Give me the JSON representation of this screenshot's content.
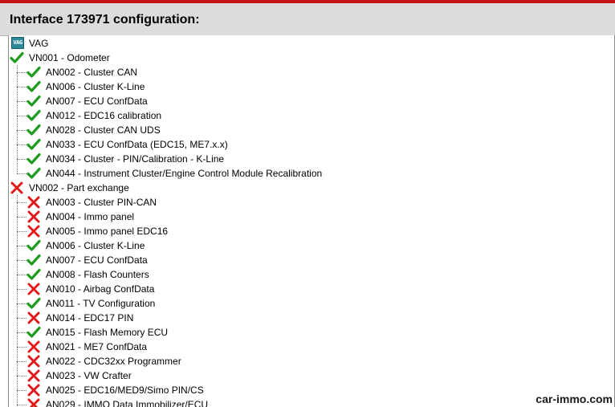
{
  "header": {
    "title": "Interface 173971 configuration:"
  },
  "tree": {
    "root": {
      "label": "VAG",
      "icon": "vag-logo-icon"
    },
    "groups": [
      {
        "label": "VN001 - Odometer",
        "status": "enabled",
        "items": [
          {
            "label": "AN002 - Cluster CAN",
            "status": "enabled"
          },
          {
            "label": "AN006 - Cluster K-Line",
            "status": "enabled"
          },
          {
            "label": "AN007 - ECU ConfData",
            "status": "enabled"
          },
          {
            "label": "AN012 - EDC16 calibration",
            "status": "enabled"
          },
          {
            "label": "AN028 - Cluster CAN UDS",
            "status": "enabled"
          },
          {
            "label": "AN033 - ECU ConfData (EDC15, ME7.x.x)",
            "status": "enabled"
          },
          {
            "label": "AN034 - Cluster - PIN/Calibration - K-Line",
            "status": "enabled"
          },
          {
            "label": "AN044 - Instrument Cluster/Engine Control Module Recalibration",
            "status": "enabled"
          }
        ]
      },
      {
        "label": "VN002 - Part exchange",
        "status": "disabled",
        "items": [
          {
            "label": "AN003 - Cluster PIN-CAN",
            "status": "disabled"
          },
          {
            "label": "AN004 - Immo panel",
            "status": "disabled"
          },
          {
            "label": "AN005 - Immo panel EDC16",
            "status": "disabled"
          },
          {
            "label": "AN006 - Cluster K-Line",
            "status": "enabled"
          },
          {
            "label": "AN007 - ECU ConfData",
            "status": "enabled"
          },
          {
            "label": "AN008 - Flash Counters",
            "status": "enabled"
          },
          {
            "label": "AN010 - Airbag ConfData",
            "status": "disabled"
          },
          {
            "label": "AN011 - TV Configuration",
            "status": "enabled"
          },
          {
            "label": "AN014 - EDC17 PIN",
            "status": "disabled"
          },
          {
            "label": "AN015 - Flash Memory ECU",
            "status": "enabled"
          },
          {
            "label": "AN021 - ME7 ConfData",
            "status": "disabled"
          },
          {
            "label": "AN022 - CDC32xx Programmer",
            "status": "disabled"
          },
          {
            "label": "AN023 - VW Crafter",
            "status": "disabled"
          },
          {
            "label": "AN025 - EDC16/MED9/Simo PIN/CS",
            "status": "disabled"
          },
          {
            "label": "AN029 - IMMO Data Immobilizer/ECU",
            "status": "disabled"
          }
        ]
      }
    ]
  },
  "icons": {
    "enabled": "green-checkmark-icon",
    "disabled": "red-x-icon"
  },
  "colors": {
    "check": "#1e9b1e",
    "cross": "#e01a1a",
    "header_bg": "#dcdcdc",
    "top_accent": "#c81414"
  },
  "watermark": "car-immo.com"
}
